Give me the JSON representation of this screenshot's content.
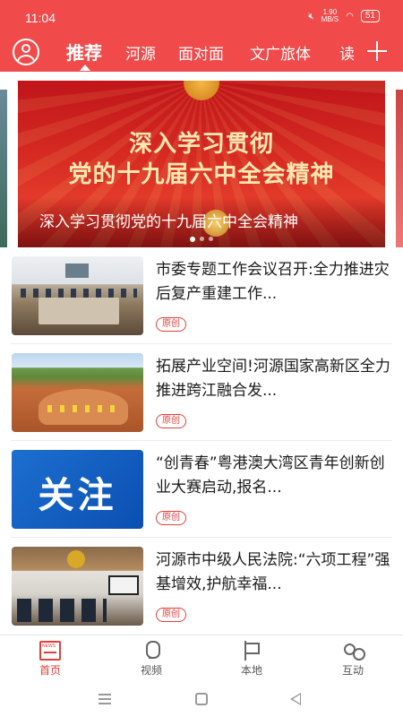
{
  "status_bar": {
    "time": "11:04",
    "net_speed_value": "1.90",
    "net_speed_unit": "MB/S",
    "battery": "51"
  },
  "top_nav": {
    "tabs": [
      {
        "label": "推荐",
        "active": true
      },
      {
        "label": "河源",
        "active": false
      },
      {
        "label": "面对面",
        "active": false
      },
      {
        "label": "文广旅体",
        "active": false
      },
      {
        "label": "读",
        "active": false
      }
    ],
    "accent_color": "#f04a4a"
  },
  "banner": {
    "headline_line1": "深入学习贯彻",
    "headline_line2": "党的十九届六中全会精神",
    "caption": "深入学习贯彻党的十九届六中全会精神",
    "pages": 3,
    "current_page": 1
  },
  "news": [
    {
      "title": "市委专题工作会议召开:全力推进灾后复产重建工作...",
      "badge": "原创",
      "thumb": "meeting"
    },
    {
      "title": "拓展产业空间!河源国家高新区全力推进跨江融合发...",
      "badge": "原创",
      "thumb": "land"
    },
    {
      "title": "“创青春”粤港澳大湾区青年创新创业大赛启动,报名...",
      "badge": "原创",
      "thumb": "focus",
      "thumb_text": "关注"
    },
    {
      "title": "河源市中级人民法院:“六项工程”强基增效,护航幸福...",
      "badge": "原创",
      "thumb": "court"
    }
  ],
  "bottom_tabs": [
    {
      "label": "首页",
      "icon": "news-icon",
      "active": true
    },
    {
      "label": "视频",
      "icon": "mic-icon",
      "active": false
    },
    {
      "label": "本地",
      "icon": "flag-icon",
      "active": false
    },
    {
      "label": "互动",
      "icon": "people-icon",
      "active": false
    }
  ]
}
